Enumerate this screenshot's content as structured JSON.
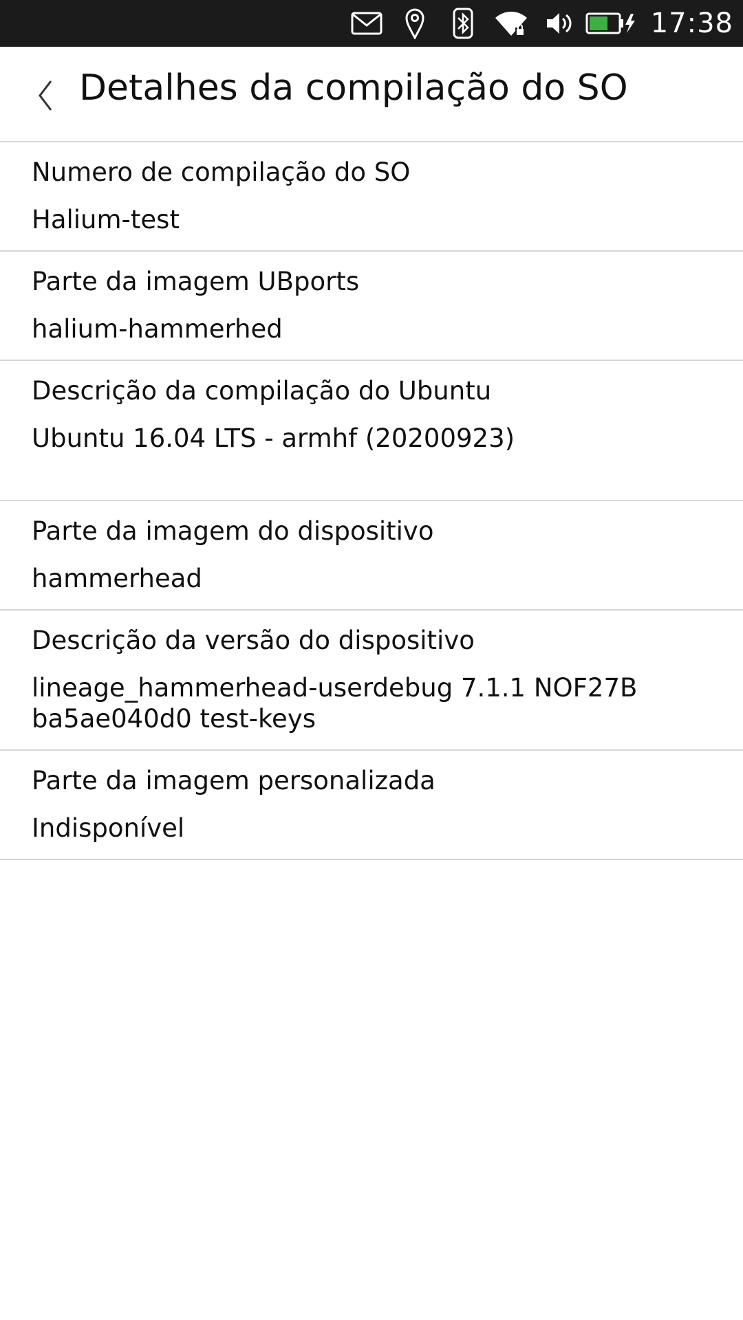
{
  "status_bar": {
    "time": "17:38",
    "icons": [
      "mail-icon",
      "location-icon",
      "bluetooth-icon",
      "wifi-secure-icon",
      "volume-icon",
      "battery-charging-icon"
    ],
    "battery_color": "#3cb043"
  },
  "header": {
    "title": "Detalhes da compilação do SO",
    "back_icon": "chevron-left-icon"
  },
  "details": [
    {
      "label": "Numero de compilação do SO",
      "value": "Halium-test"
    },
    {
      "label": "Parte da imagem UBports",
      "value": "halium-hammerhed"
    },
    {
      "label": "Descrição da compilação do Ubuntu",
      "value": "Ubuntu 16.04 LTS - armhf (20200923)"
    },
    {
      "label": "Parte da imagem do dispositivo",
      "value": "hammerhead"
    },
    {
      "label": "Descrição da versão do dispositivo",
      "value": "lineage_hammerhead-userdebug 7.1.1 NOF27B ba5ae040d0 test-keys"
    },
    {
      "label": "Parte da imagem personalizada",
      "value": "Indisponível"
    }
  ]
}
